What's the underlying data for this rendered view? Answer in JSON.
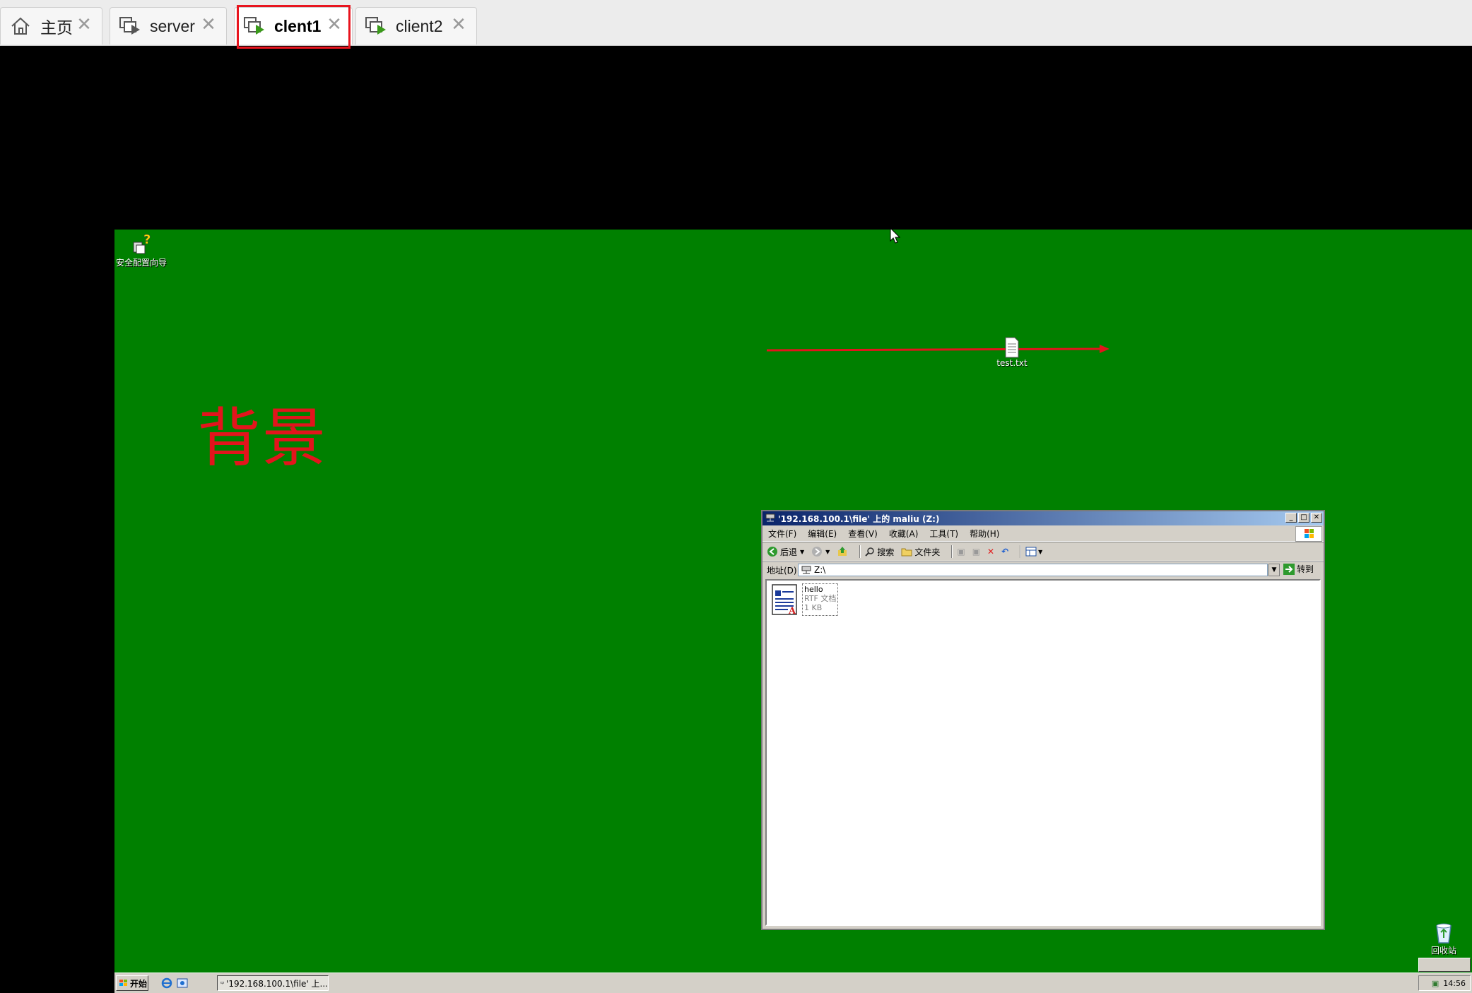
{
  "tabs": [
    {
      "label": "主页",
      "icon": "home-icon",
      "active": false
    },
    {
      "label": "server",
      "icon": "vm-icon",
      "active": false
    },
    {
      "label": "clent1",
      "icon": "vm-running-icon",
      "active": true
    },
    {
      "label": "client2",
      "icon": "vm-running-icon",
      "active": false
    }
  ],
  "desktop": {
    "background_color": "#008000",
    "annotation_label": "背景",
    "icons": {
      "security_wizard": "安全配置向导",
      "test_file": "test.txt",
      "recycle_bin": "回收站"
    }
  },
  "explorer": {
    "title": "'192.168.100.1\\file' 上的 maliu (Z:)",
    "menu": [
      "文件(F)",
      "编辑(E)",
      "查看(V)",
      "收藏(A)",
      "工具(T)",
      "帮助(H)"
    ],
    "toolbar": {
      "back": "后退",
      "search": "搜索",
      "folders": "文件夹"
    },
    "address_label": "地址(D)",
    "address_value": "Z:\\",
    "goto_label": "转到",
    "files": [
      {
        "name": "hello",
        "type": "RTF 文档",
        "size": "1 KB"
      }
    ]
  },
  "taskbar": {
    "start_label": "开始",
    "task_item": "'192.168.100.1\\file' 上...",
    "clock": "14:56"
  },
  "colors": {
    "annotation": "#e3141c",
    "highlight": "#e8141e"
  }
}
